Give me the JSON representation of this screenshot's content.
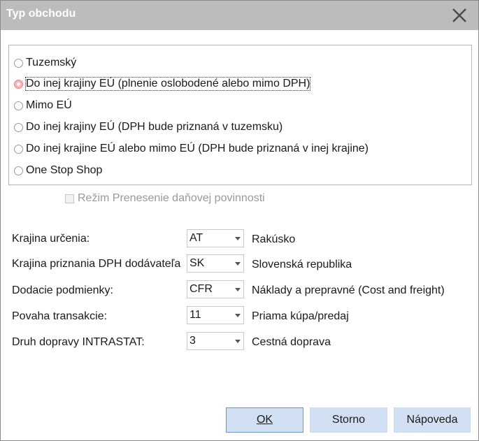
{
  "window": {
    "title": "Typ obchodu",
    "close_icon": "close-icon"
  },
  "trade_type": {
    "options": [
      {
        "label": "Tuzemský",
        "checked": false
      },
      {
        "label": "Do inej krajiny EÚ (plnenie oslobodené alebo mimo DPH)",
        "checked": true
      },
      {
        "label": "Mimo EÚ",
        "checked": false
      },
      {
        "label": "Do inej krajiny EÚ (DPH bude priznaná v tuzemsku)",
        "checked": false
      },
      {
        "label": "Do inej krajine EÚ alebo mimo EÚ (DPH bude priznaná v inej krajine)",
        "checked": false
      },
      {
        "label": "One Stop Shop",
        "checked": false
      }
    ]
  },
  "reverse_charge": {
    "label": "Režim Prenesenie daňovej povinnosti",
    "checked": false,
    "enabled": false
  },
  "fields": [
    {
      "label": "Krajina určenia:",
      "value": "AT",
      "description": "Rakúsko"
    },
    {
      "label": "Krajina priznania DPH dodávateľa",
      "value": "SK",
      "description": "Slovenská republika"
    },
    {
      "label": "Dodacie podmienky:",
      "value": "CFR",
      "description": "Náklady a prepravné  (Cost and freight)"
    },
    {
      "label": "Povaha transakcie:",
      "value": "11",
      "description": "Priama kúpa/predaj"
    },
    {
      "label": "Druh dopravy INTRASTAT:",
      "value": "3",
      "description": "Cestná doprava"
    }
  ],
  "buttons": {
    "ok": "OK",
    "cancel": "Storno",
    "help": "Nápoveda"
  }
}
